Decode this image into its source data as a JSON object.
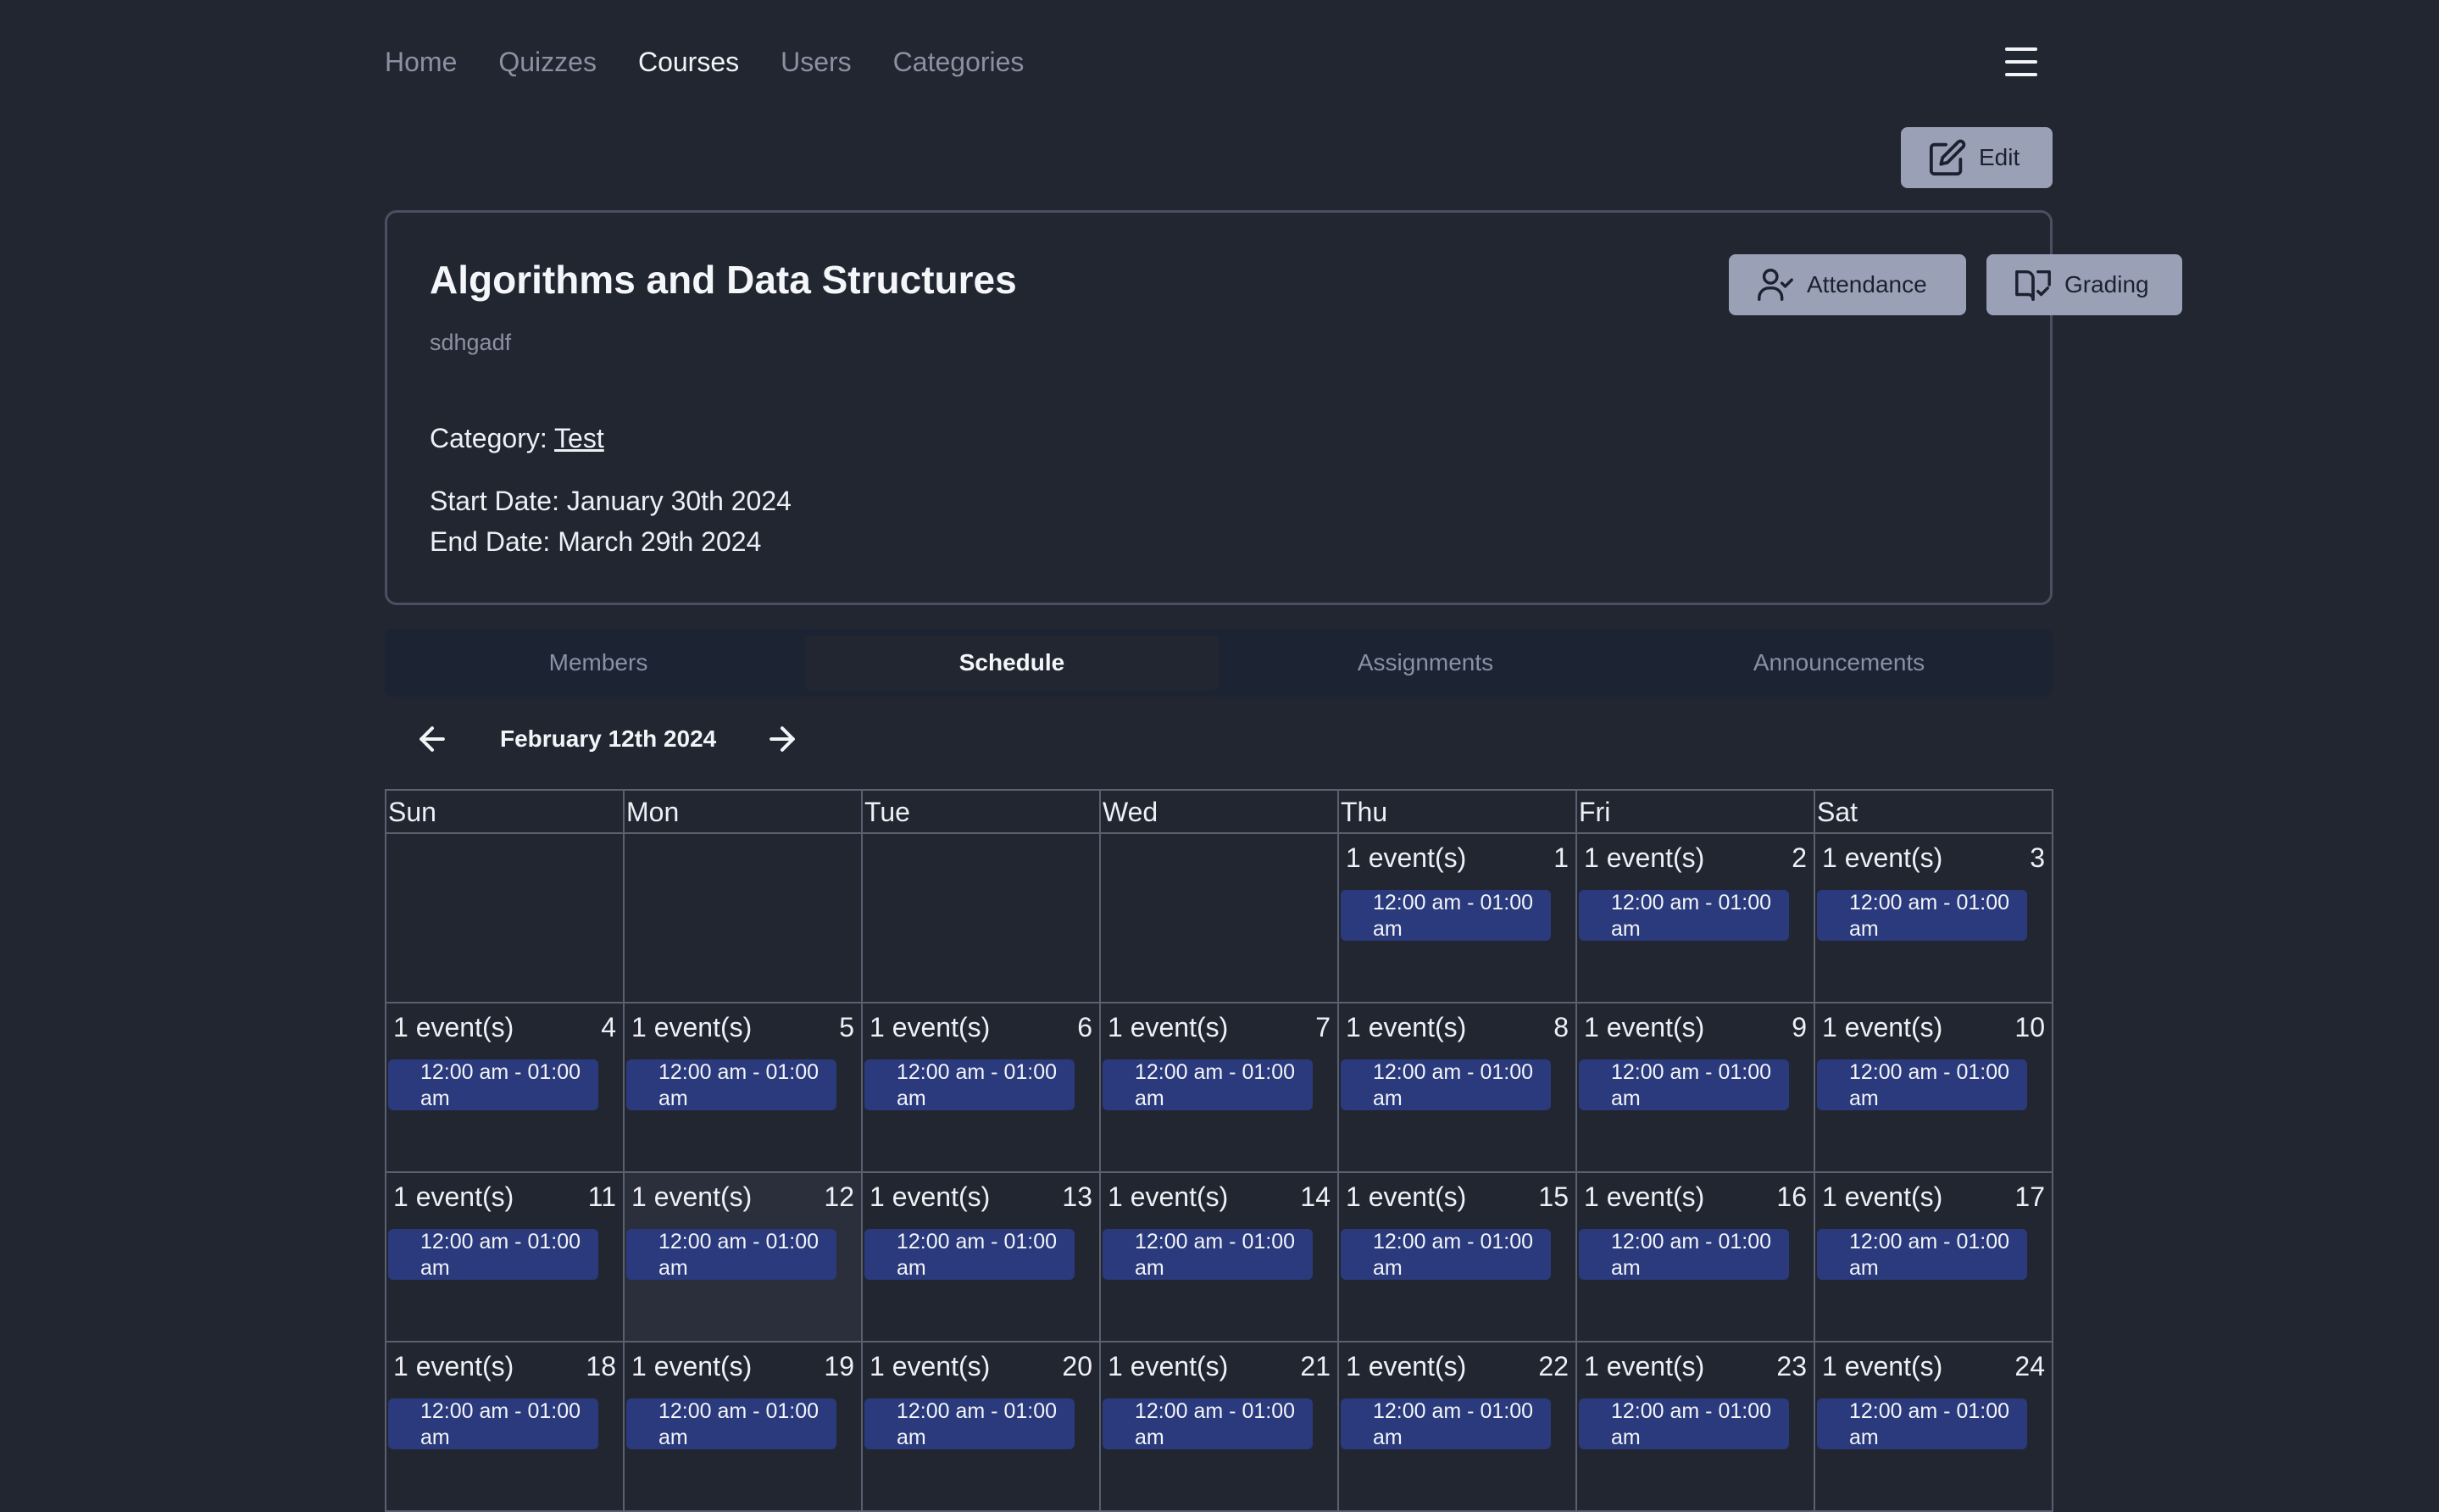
{
  "nav": {
    "items": [
      "Home",
      "Quizzes",
      "Courses",
      "Users",
      "Categories"
    ],
    "active": "Courses"
  },
  "actions": {
    "edit_label": "Edit"
  },
  "course": {
    "title": "Algorithms and Data Structures",
    "description": "sdhgadf",
    "category_label": "Category:",
    "category": "Test",
    "start_date": "Start Date: January 30th 2024",
    "end_date": "End Date: March 29th 2024",
    "attendance_label": "Attendance",
    "grading_label": "Grading"
  },
  "tabs": [
    {
      "label": "Members",
      "active": false
    },
    {
      "label": "Schedule",
      "active": true
    },
    {
      "label": "Assignments",
      "active": false
    },
    {
      "label": "Announcements",
      "active": false
    }
  ],
  "calendar": {
    "current": "February 12th 2024",
    "weekdays": [
      "Sun",
      "Mon",
      "Tue",
      "Wed",
      "Thu",
      "Fri",
      "Sat"
    ],
    "today": 12,
    "weeks": [
      [
        null,
        null,
        null,
        null,
        {
          "day": "1",
          "count": "1 event(s)",
          "event": "12:00 am - 01:00 am"
        },
        {
          "day": "2",
          "count": "1 event(s)",
          "event": "12:00 am - 01:00 am"
        },
        {
          "day": "3",
          "count": "1 event(s)",
          "event": "12:00 am - 01:00 am"
        }
      ],
      [
        {
          "day": "4",
          "count": "1 event(s)",
          "event": "12:00 am - 01:00 am"
        },
        {
          "day": "5",
          "count": "1 event(s)",
          "event": "12:00 am - 01:00 am"
        },
        {
          "day": "6",
          "count": "1 event(s)",
          "event": "12:00 am - 01:00 am"
        },
        {
          "day": "7",
          "count": "1 event(s)",
          "event": "12:00 am - 01:00 am"
        },
        {
          "day": "8",
          "count": "1 event(s)",
          "event": "12:00 am - 01:00 am"
        },
        {
          "day": "9",
          "count": "1 event(s)",
          "event": "12:00 am - 01:00 am"
        },
        {
          "day": "10",
          "count": "1 event(s)",
          "event": "12:00 am - 01:00 am"
        }
      ],
      [
        {
          "day": "11",
          "count": "1 event(s)",
          "event": "12:00 am - 01:00 am"
        },
        {
          "day": "12",
          "count": "1 event(s)",
          "event": "12:00 am - 01:00 am"
        },
        {
          "day": "13",
          "count": "1 event(s)",
          "event": "12:00 am - 01:00 am"
        },
        {
          "day": "14",
          "count": "1 event(s)",
          "event": "12:00 am - 01:00 am"
        },
        {
          "day": "15",
          "count": "1 event(s)",
          "event": "12:00 am - 01:00 am"
        },
        {
          "day": "16",
          "count": "1 event(s)",
          "event": "12:00 am - 01:00 am"
        },
        {
          "day": "17",
          "count": "1 event(s)",
          "event": "12:00 am - 01:00 am"
        }
      ],
      [
        {
          "day": "18",
          "count": "1 event(s)",
          "event": "12:00 am - 01:00 am"
        },
        {
          "day": "19",
          "count": "1 event(s)",
          "event": "12:00 am - 01:00 am"
        },
        {
          "day": "20",
          "count": "1 event(s)",
          "event": "12:00 am - 01:00 am"
        },
        {
          "day": "21",
          "count": "1 event(s)",
          "event": "12:00 am - 01:00 am"
        },
        {
          "day": "22",
          "count": "1 event(s)",
          "event": "12:00 am - 01:00 am"
        },
        {
          "day": "23",
          "count": "1 event(s)",
          "event": "12:00 am - 01:00 am"
        },
        {
          "day": "24",
          "count": "1 event(s)",
          "event": "12:00 am - 01:00 am"
        }
      ]
    ]
  },
  "colors": {
    "background": "#222631",
    "button": "#9aa1b6",
    "event": "#2a3a7c",
    "tabs_bg": "#1c2333"
  }
}
